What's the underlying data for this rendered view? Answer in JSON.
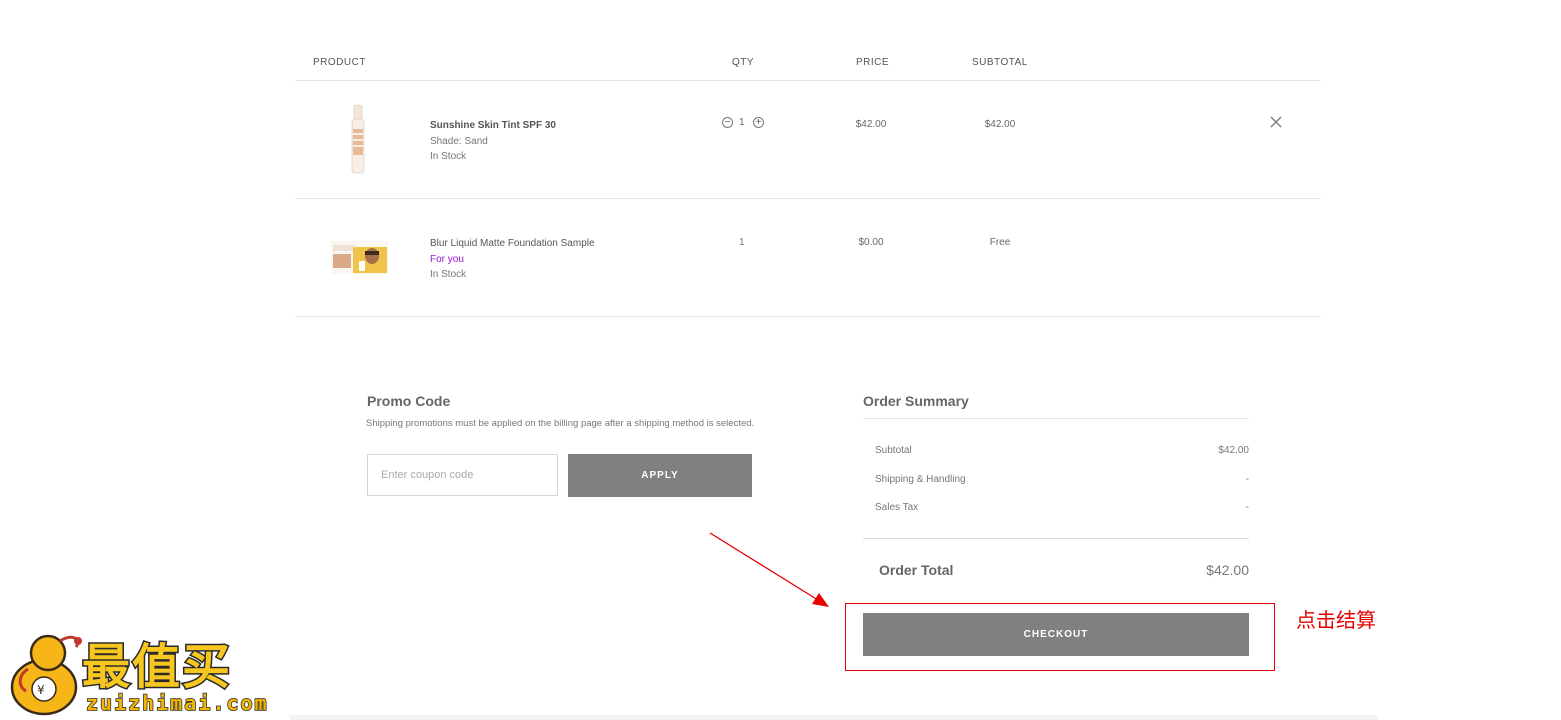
{
  "table": {
    "headers": {
      "product": "PRODUCT",
      "qty": "QTY",
      "price": "PRICE",
      "subtotal": "SUBTOTAL"
    },
    "rows": [
      {
        "name": "Sunshine Skin Tint SPF 30",
        "meta1": "Shade: Sand",
        "meta2": "In Stock",
        "qty": "1",
        "price": "$42.00",
        "subtotal": "$42.00"
      },
      {
        "name": "Blur Liquid Matte Foundation Sample",
        "meta1": "For you",
        "meta2": "In Stock",
        "qty": "1",
        "price": "$0.00",
        "subtotal": "Free"
      }
    ]
  },
  "promo": {
    "title": "Promo Code",
    "note": "Shipping promotions must be applied on the billing page after a shipping method is selected.",
    "placeholder": "Enter coupon code",
    "apply_label": "APPLY"
  },
  "summary": {
    "title": "Order Summary",
    "subtotal_label": "Subtotal",
    "subtotal_value": "$42.00",
    "shipping_label": "Shipping & Handling",
    "shipping_value": "-",
    "tax_label": "Sales Tax",
    "tax_value": "-",
    "total_label": "Order Total",
    "total_value": "$42.00",
    "checkout_label": "CHECKOUT"
  },
  "annotation": {
    "text": "点击结算",
    "color": "#e60000"
  },
  "watermark": {
    "brand": "最值买",
    "url": "zuizhimai.com"
  },
  "colors": {
    "button": "#808080",
    "purple": "#9b14d9",
    "divider": "#e3e3e3"
  }
}
